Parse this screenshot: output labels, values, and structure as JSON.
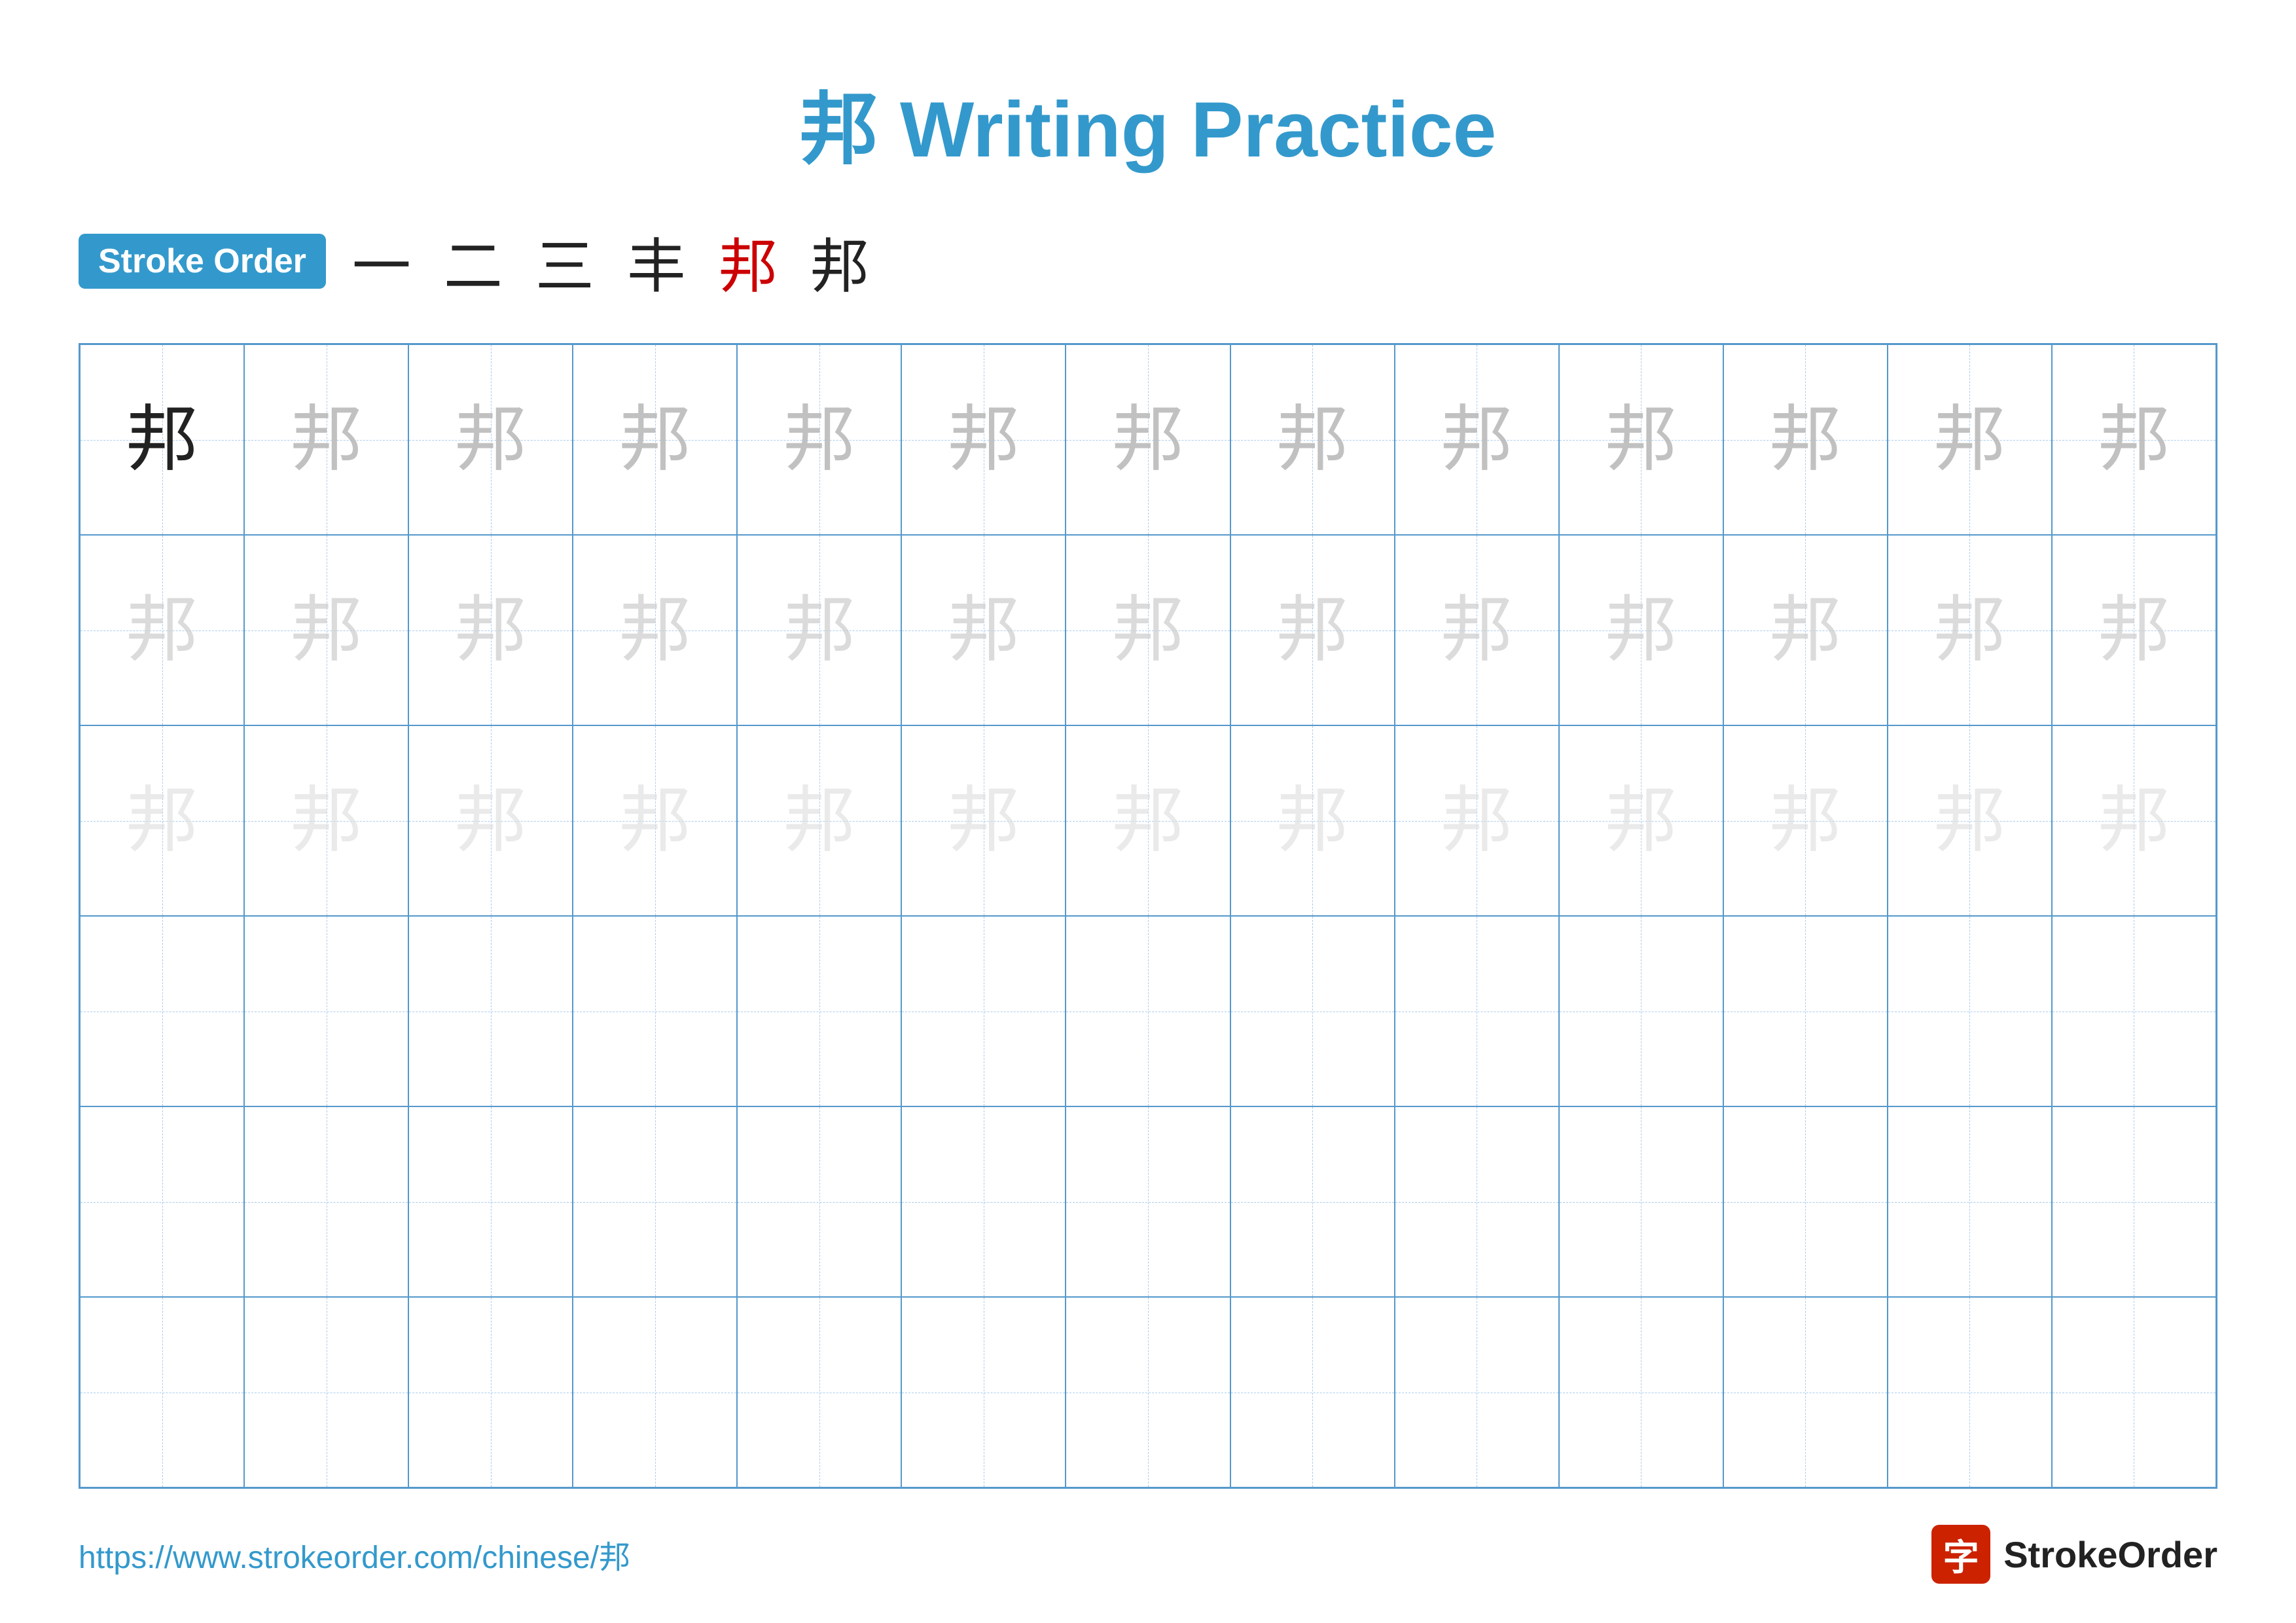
{
  "title": {
    "char": "邦",
    "text": " Writing Practice",
    "full": "邦 Writing Practice"
  },
  "stroke_order": {
    "badge_label": "Stroke Order",
    "steps": [
      "一",
      "二",
      "三",
      "丰",
      "邦",
      "邦"
    ]
  },
  "grid": {
    "cols": 13,
    "rows": 6,
    "char": "邦",
    "filled_rows": 3,
    "empty_rows": 3
  },
  "footer": {
    "url": "https://www.strokeorder.com/chinese/邦",
    "logo_char": "字",
    "logo_text": "StrokeOrder"
  }
}
